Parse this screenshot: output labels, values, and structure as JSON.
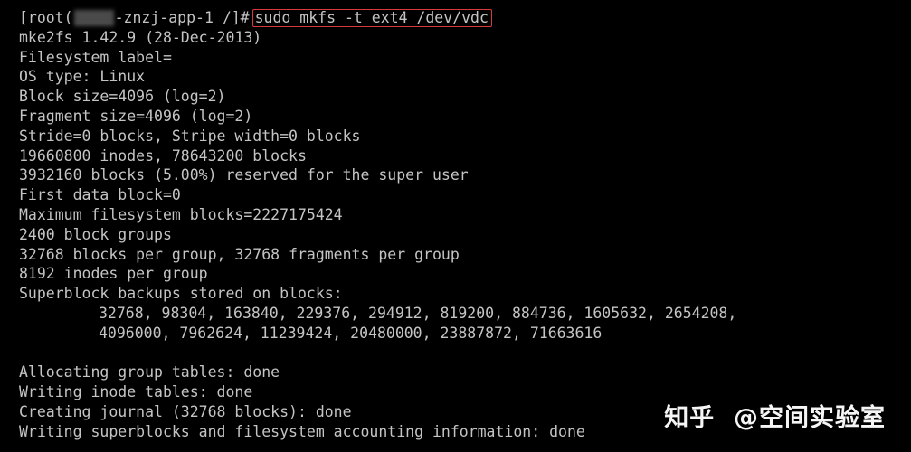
{
  "prompt": {
    "prefix": "[root(",
    "suffix": "-znzj-app-1 /]#",
    "command": "sudo mkfs -t ext4 /dev/vdc"
  },
  "output": [
    "mke2fs 1.42.9 (28-Dec-2013)",
    "Filesystem label=",
    "OS type: Linux",
    "Block size=4096 (log=2)",
    "Fragment size=4096 (log=2)",
    "Stride=0 blocks, Stripe width=0 blocks",
    "19660800 inodes, 78643200 blocks",
    "3932160 blocks (5.00%) reserved for the super user",
    "First data block=0",
    "Maximum filesystem blocks=2227175424",
    "2400 block groups",
    "32768 blocks per group, 32768 fragments per group",
    "8192 inodes per group",
    "Superblock backups stored on blocks:"
  ],
  "backups": [
    "32768, 98304, 163840, 229376, 294912, 819200, 884736, 1605632, 2654208,",
    "4096000, 7962624, 11239424, 20480000, 23887872, 71663616"
  ],
  "status": [
    "Allocating group tables: done",
    "Writing inode tables: done",
    "Creating journal (32768 blocks): done",
    "Writing superblocks and filesystem accounting information: done"
  ],
  "watermark": {
    "brand": "知乎",
    "author": "@空间实验室"
  }
}
